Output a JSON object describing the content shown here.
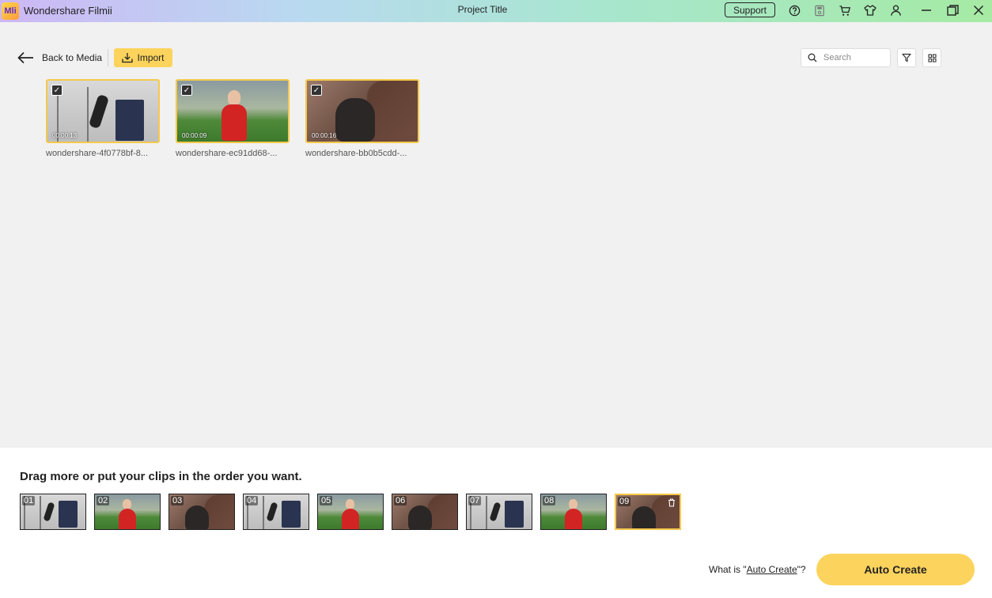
{
  "titlebar": {
    "logo_text": "Mli",
    "app_name": "Wondershare Filmii",
    "project_title": "Project Title",
    "support_label": "Support"
  },
  "toolbar": {
    "back_label": "Back to Media",
    "import_label": "Import",
    "search_placeholder": "Search"
  },
  "media": [
    {
      "duration": "00:00:13",
      "name": "wondershare-4f0778bf-8...",
      "thumb": "gym"
    },
    {
      "duration": "00:00:09",
      "name": "wondershare-ec91dd68-...",
      "thumb": "red"
    },
    {
      "duration": "00:00:16",
      "name": "wondershare-bb0b5cdd-...",
      "thumb": "dog"
    }
  ],
  "bottom": {
    "title": "Drag more or put your clips in the order you want.",
    "clips": [
      {
        "num": "01",
        "thumb": "gym"
      },
      {
        "num": "02",
        "thumb": "red"
      },
      {
        "num": "03",
        "thumb": "dog"
      },
      {
        "num": "04",
        "thumb": "gym"
      },
      {
        "num": "05",
        "thumb": "red"
      },
      {
        "num": "06",
        "thumb": "dog"
      },
      {
        "num": "07",
        "thumb": "gym"
      },
      {
        "num": "08",
        "thumb": "red"
      },
      {
        "num": "09",
        "thumb": "dog",
        "selected": true
      }
    ],
    "whatis_prefix": "What is \"",
    "whatis_link": "Auto Create",
    "whatis_suffix": "\"?",
    "auto_create_label": "Auto Create"
  },
  "colors": {
    "accent": "#fcd35c",
    "selected_border": "#f5c94a"
  }
}
